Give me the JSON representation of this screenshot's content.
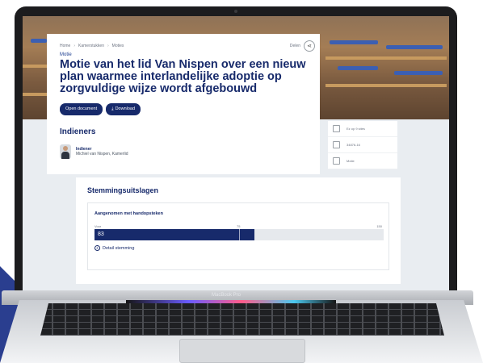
{
  "device": {
    "brand_label": "MacBook Pro"
  },
  "breadcrumb": [
    "Home",
    "Kamerstukken",
    "Moties"
  ],
  "share": {
    "label": "Delen"
  },
  "document": {
    "type": "Motie",
    "title": "Motie van het lid Van Nispen over een nieuw plan waarmee interlandelijke adoptie op zorgvuldige wijze wordt afgebouwd",
    "open_button": "Open document",
    "download_button": "Download"
  },
  "indieners": {
    "heading": "Indieners",
    "person": {
      "role": "Indiener",
      "name": "Michiel van Nispen, Kamerlid"
    }
  },
  "side_panel": [
    "Ez op 9 sites",
    "34876-16",
    "Motie"
  ],
  "stemming": {
    "heading": "Stemmingsuitslagen",
    "result": "Aangenomen met handopsteken",
    "label_left": "Voor",
    "label_mid": "75",
    "label_right": "150",
    "value": 83,
    "max": 150,
    "threshold": 75,
    "detail_link": "Detail stemming"
  },
  "colors": {
    "primary": "#172a6b",
    "accent": "#2a3e8f"
  },
  "icons": [
    "share-icon",
    "download-icon",
    "calendar-icon",
    "document-icon",
    "plus-circle-icon"
  ]
}
